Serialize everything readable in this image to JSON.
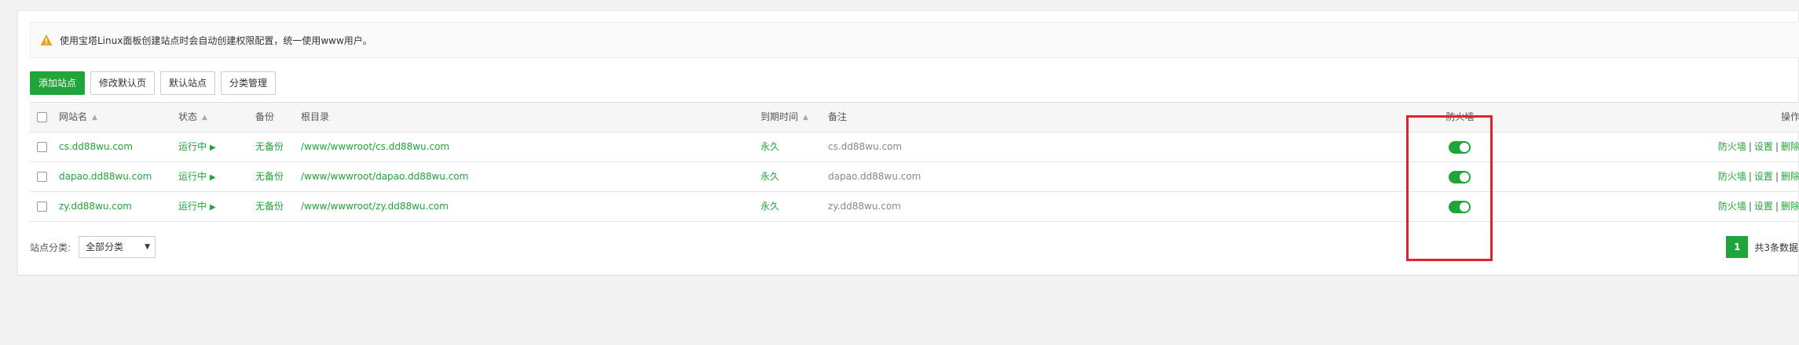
{
  "notice": {
    "text": "使用宝塔Linux面板创建站点时会自动创建权限配置，统一使用www用户。",
    "icon": "warning-icon"
  },
  "toolbar": {
    "add_site": "添加站点",
    "edit_default_page": "修改默认页",
    "default_site": "默认站点",
    "category_manage": "分类管理"
  },
  "table": {
    "headers": {
      "site_name": "网站名",
      "status": "状态",
      "backup": "备份",
      "root_dir": "根目录",
      "expire": "到期时间",
      "note": "备注",
      "firewall": "防火墙",
      "ops": "操作"
    },
    "rows": [
      {
        "name": "cs.dd88wu.com",
        "status": "运行中",
        "backup": "无备份",
        "root": "/www/wwwroot/cs.dd88wu.com",
        "expire": "永久",
        "note": "cs.dd88wu.com",
        "firewall_on": true
      },
      {
        "name": "dapao.dd88wu.com",
        "status": "运行中",
        "backup": "无备份",
        "root": "/www/wwwroot/dapao.dd88wu.com",
        "expire": "永久",
        "note": "dapao.dd88wu.com",
        "firewall_on": true
      },
      {
        "name": "zy.dd88wu.com",
        "status": "运行中",
        "backup": "无备份",
        "root": "/www/wwwroot/zy.dd88wu.com",
        "expire": "永久",
        "note": "zy.dd88wu.com",
        "firewall_on": true
      }
    ],
    "row_actions": {
      "firewall": "防火墙",
      "settings": "设置",
      "delete": "删除",
      "separator": "|"
    }
  },
  "footer": {
    "category_label": "站点分类:",
    "category_selected": "全部分类",
    "current_page": "1",
    "total_text": "共3条数据"
  },
  "colors": {
    "accent": "#20a53a",
    "highlight": "#e0232a"
  }
}
